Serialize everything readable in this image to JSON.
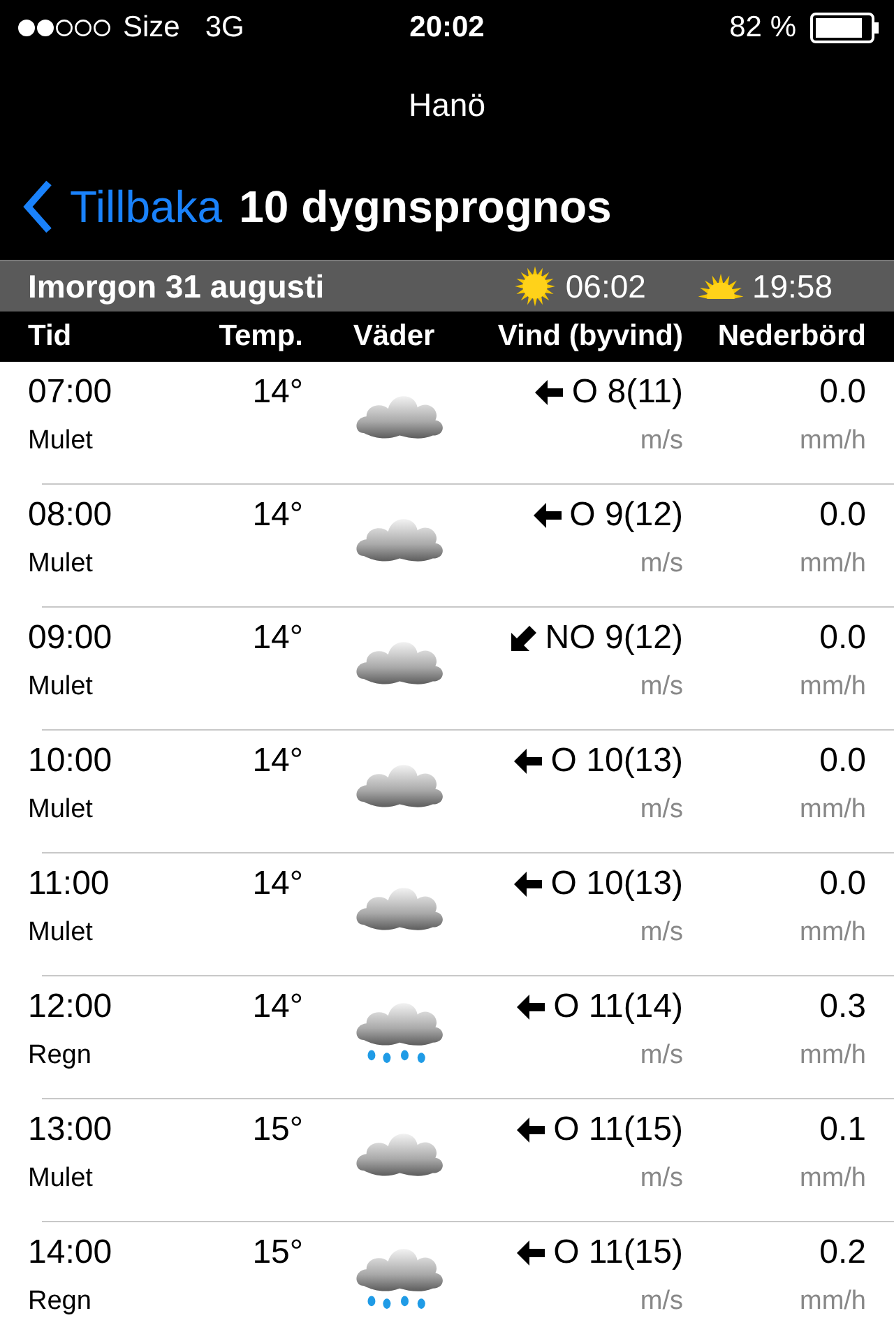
{
  "status_bar": {
    "carrier": "Size",
    "network": "3G",
    "time": "20:02",
    "battery": "82 %"
  },
  "header": {
    "location": "Hanö",
    "back": "Tillbaka",
    "title": "10 dygnsprognos"
  },
  "day_bar": {
    "date": "Imorgon 31 augusti",
    "sunrise": "06:02",
    "sunset": "19:58"
  },
  "table": {
    "columns": [
      "Tid",
      "Temp.",
      "Väder",
      "Vind (byvind)",
      "Nederbörd"
    ],
    "rows": [
      {
        "time": "07:00",
        "condition": "Mulet",
        "temp": "14°",
        "weather": {
          "kind": "cloud"
        },
        "wind": {
          "kind": "left",
          "speed": "O 8(11)",
          "unit": "m/s"
        },
        "precip": "0.0",
        "precip_unit": "mm/h"
      },
      {
        "time": "08:00",
        "condition": "Mulet",
        "temp": "14°",
        "weather": {
          "kind": "cloud"
        },
        "wind": {
          "kind": "left",
          "speed": "O 9(12)",
          "unit": "m/s"
        },
        "precip": "0.0",
        "precip_unit": "mm/h"
      },
      {
        "time": "09:00",
        "condition": "Mulet",
        "temp": "14°",
        "weather": {
          "kind": "cloud"
        },
        "wind": {
          "kind": "down-left",
          "speed": "NO 9(12)",
          "unit": "m/s"
        },
        "precip": "0.0",
        "precip_unit": "mm/h"
      },
      {
        "time": "10:00",
        "condition": "Mulet",
        "temp": "14°",
        "weather": {
          "kind": "cloud"
        },
        "wind": {
          "kind": "left",
          "speed": "O 10(13)",
          "unit": "m/s"
        },
        "precip": "0.0",
        "precip_unit": "mm/h"
      },
      {
        "time": "11:00",
        "condition": "Mulet",
        "temp": "14°",
        "weather": {
          "kind": "cloud"
        },
        "wind": {
          "kind": "left",
          "speed": "O 10(13)",
          "unit": "m/s"
        },
        "precip": "0.0",
        "precip_unit": "mm/h"
      },
      {
        "time": "12:00",
        "condition": "Regn",
        "temp": "14°",
        "weather": {
          "kind": "rain"
        },
        "wind": {
          "kind": "left",
          "speed": "O 11(14)",
          "unit": "m/s"
        },
        "precip": "0.3",
        "precip_unit": "mm/h"
      },
      {
        "time": "13:00",
        "condition": "Mulet",
        "temp": "15°",
        "weather": {
          "kind": "cloud"
        },
        "wind": {
          "kind": "left",
          "speed": "O 11(15)",
          "unit": "m/s"
        },
        "precip": "0.1",
        "precip_unit": "mm/h"
      },
      {
        "time": "14:00",
        "condition": "Regn",
        "temp": "15°",
        "weather": {
          "kind": "rain"
        },
        "wind": {
          "kind": "left",
          "speed": "O 11(15)",
          "unit": "m/s"
        },
        "precip": "0.2",
        "precip_unit": "mm/h"
      }
    ]
  }
}
